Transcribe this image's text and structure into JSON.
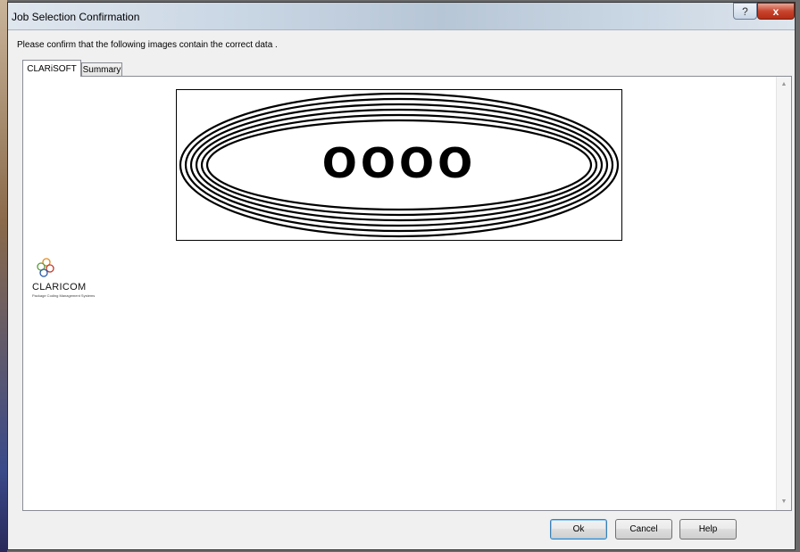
{
  "window": {
    "title": "Job Selection Confirmation",
    "help_icon": "question-mark-icon",
    "close_icon": "close-x-icon",
    "help_glyph": "?",
    "close_glyph": "x"
  },
  "instruction": "Please confirm that the following images contain the correct data .",
  "tabs": [
    {
      "label": "CLARiSOFT",
      "active": true
    },
    {
      "label": "Summary",
      "active": false
    }
  ],
  "label_preview": {
    "text": "OOOO"
  },
  "logo": {
    "name": "CLARICOM",
    "tagline": "Package Coding Management Systems"
  },
  "buttons": {
    "ok": "Ok",
    "cancel": "Cancel",
    "help": "Help"
  }
}
